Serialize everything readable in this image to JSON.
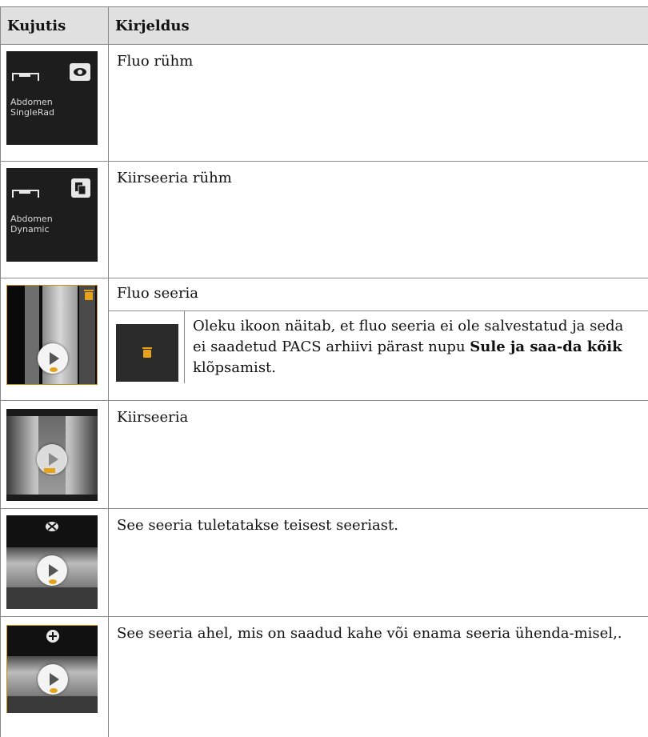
{
  "header": {
    "col_image": "Kujutis",
    "col_description": "Kirjeldus"
  },
  "rows": [
    {
      "thumb_label_1": "Abdomen",
      "thumb_label_2": "SingleRad",
      "description": "Fluo rühm"
    },
    {
      "thumb_label_1": "Abdomen",
      "thumb_label_2": "Dynamic",
      "description": "Kiirseeria rühm"
    },
    {
      "description": "Fluo seeria",
      "sub_text_before": "Oleku ikoon näitab, et fluo seeria ei ole salvestatud ja seda ei saadetud PACS arhiivi pärast nupu ",
      "sub_text_bold": "Sule ja saa-da kõik",
      "sub_text_after": " klõpsamist."
    },
    {
      "description": "Kiirseeria"
    },
    {
      "description": "See seeria tuletatakse teisest seeriast."
    },
    {
      "description": "See seeria ahel, mis on saadud kahe või enama seeria ühenda-misel,."
    }
  ],
  "colors": {
    "accent": "#e6a31a",
    "thumb_bg": "#1d1d1d",
    "header_bg": "#e0e0e0"
  },
  "icons": [
    "table-icon",
    "eye-icon",
    "series-stack-icon",
    "trash-icon",
    "play-icon",
    "scissors-icon",
    "plus-icon"
  ]
}
